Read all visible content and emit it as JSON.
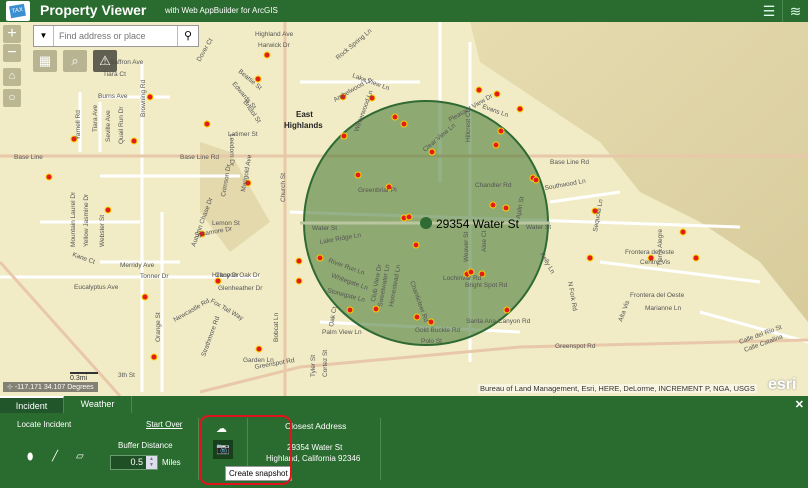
{
  "header": {
    "title": "Property Viewer",
    "subtitle": "with Web AppBuilder for ArcGIS",
    "logo_text": "TAX"
  },
  "search": {
    "placeholder": "Find address or place"
  },
  "map": {
    "incident_label": "29354 Water St",
    "place_label": [
      "East",
      "Highlands"
    ],
    "streets": [
      "Highland Ave",
      "Harwick Dr",
      "Saffron Ave",
      "Dover Ct",
      "Beattie St",
      "Edwards St",
      "Tiara Ct",
      "Burns Ave",
      "Bristol St",
      "Yarnell Rd",
      "Tiara Ave",
      "Seville Ave",
      "Quail Run Dr",
      "Browning Rd",
      "Latimer St",
      "Leedom Dr",
      "Base Line",
      "Base Line Rd",
      "Base Line Rd",
      "Church St",
      "Mountain Laurel Dr",
      "Yellow Jasmine Dr",
      "Webster St",
      "Autumn Chase Dr",
      "Crimson Dr",
      "Marigold Ave",
      "Lemon St",
      "Sycamore Dr",
      "Kane Ct",
      "Hilltop Dr",
      "Merridy Ave",
      "Tonner Dr",
      "Canyon Oak Dr",
      "Eucalyptus Ave",
      "Glenheather Dr",
      "Fox Tail Way",
      "Orange St",
      "Newcastle Rd",
      "Strathmore Rd",
      "Bobcat Ln",
      "Garden Ln",
      "Greenspot Rd",
      "Greenspot Rd",
      "3th St",
      "Lake View Ln",
      "Ambelwood Ln",
      "Winterwood Ln",
      "Clear View Ln",
      "Pleasant View Dr",
      "Evans Ln",
      "Hillcrest Ct",
      "Greenbriar Pl",
      "Chandler Rd",
      "Southwood Ln",
      "Water St",
      "Water St",
      "Lake Ridge Ln",
      "River Run Ln",
      "Whitegate Ln",
      "Stonegate Ln",
      "Club View Dr",
      "Sweetwater Ln",
      "Homestead Ln",
      "Chanticleer Rd",
      "Lochinvar Rd",
      "Bright Spot Rd",
      "Santa Ana Canyon Rd",
      "Gold Buckle Rd",
      "Polo St",
      "Palm View Ln",
      "Oak Ct",
      "Aloe Ct",
      "Weaver St",
      "Aplin St",
      "Kelly Ln",
      "Frontera del este",
      "Centro Vis",
      "Tierra Alegre",
      "Frontera del Oeste",
      "Marianne Ln",
      "Alta Vis",
      "Calle del Rio St",
      "Calle Catalina",
      "Tyler St",
      "Cortez St",
      "N Fork Rd",
      "Sequoia Ln",
      "Rock Spring Ln"
    ],
    "scale_label": "0.3mi",
    "coordinates": "-117.171 34.107 Degrees",
    "attribution": "Bureau of Land Management, Esri, HERE, DeLorme, INCREMENT P, NGA, USGS",
    "esri_logo": "esri"
  },
  "panel": {
    "tabs": [
      {
        "label": "Incident"
      },
      {
        "label": "Weather"
      }
    ],
    "locate_label": "Locate Incident",
    "start_over": "Start Over",
    "buffer_label": "Buffer Distance",
    "buffer_value": "0.5",
    "buffer_unit": "Miles",
    "closest_title": "Closest Address",
    "address_line1": "29354 Water St",
    "address_line2": "Highland, California 92346",
    "tooltip": "Create snapshot"
  },
  "colors": {
    "header": "#2a6b2f",
    "buffer": "#4f7d3b",
    "parcel": "#e41a1c",
    "highlight": "#e0141c"
  }
}
